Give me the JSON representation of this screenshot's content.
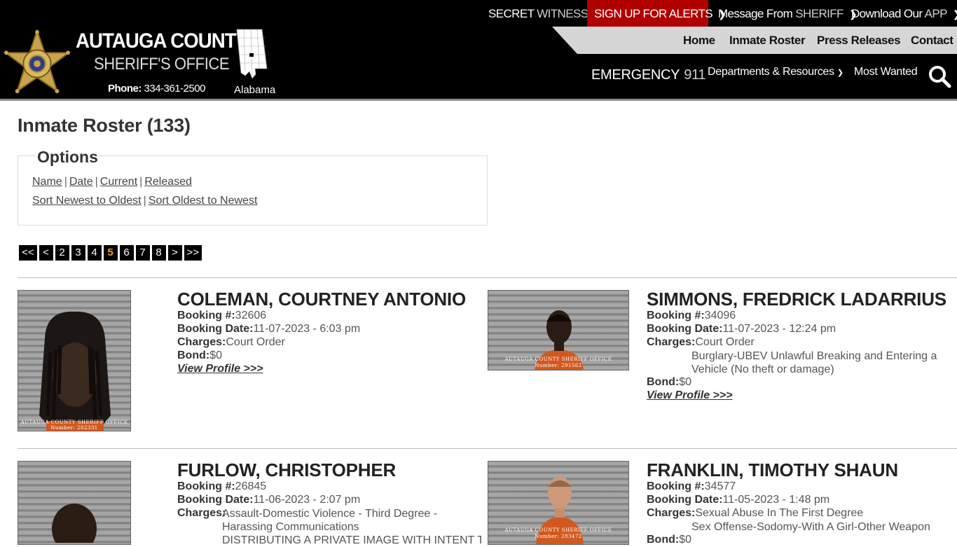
{
  "topbar": {
    "secret_witness_a": "SECRET",
    "secret_witness_b": "WITNESS",
    "alerts_a": "SIGN UP",
    "alerts_b": "FOR ALERTS",
    "message_a": "Message From",
    "message_b": "SHERIFF",
    "download_a": "Download Our",
    "download_b": "APP"
  },
  "header": {
    "brand_line1": "AUTAUGA COUNTY",
    "brand_line2": "SHERIFF'S OFFICE",
    "phone_label": "Phone:",
    "phone_number": "334-361-2500",
    "state": "Alabama"
  },
  "nav": {
    "home": "Home",
    "inmate_roster": "Inmate Roster",
    "press_releases": "Press Releases",
    "contact": "Contact",
    "emergency_label": "EMERGENCY",
    "emergency_number": "911",
    "departments": "Departments & Resources",
    "most_wanted": "Most Wanted"
  },
  "page": {
    "title": "Inmate Roster (133)",
    "options_legend": "Options",
    "filter_links": [
      "Name",
      "Date",
      "Current",
      "Released"
    ],
    "sort_links": [
      "Sort Newest to Oldest",
      "Sort Oldest to Newest"
    ],
    "pager": [
      "<<",
      "<",
      "2",
      "3",
      "4",
      "5",
      "6",
      "7",
      "8",
      ">",
      ">>"
    ],
    "pager_current": "5"
  },
  "inmates": [
    {
      "name": "COLEMAN, COURTNEY ANTONIO",
      "booking_no_label": "Booking #:",
      "booking_no": "32606",
      "booking_date_label": "Booking Date:",
      "booking_date": "11-07-2023 - 6:03 pm",
      "charges_label": "Charges:",
      "charges": [
        "Court Order"
      ],
      "bond_label": "Bond:",
      "bond": "$0",
      "view": "View Profile >>>",
      "photo_caption_a": "AUTAUGA COUNTY SHERIFF OFFICE",
      "photo_caption_b": "Number: 202331"
    },
    {
      "name": "SIMMONS, FREDRICK LADARRIUS",
      "booking_no_label": "Booking #:",
      "booking_no": "34096",
      "booking_date_label": "Booking Date:",
      "booking_date": "11-07-2023 - 12:24 pm",
      "charges_label": "Charges:",
      "charges": [
        "Court Order",
        "Burglary-UBEV Unlawful Breaking and Entering a Vehicle (No theft or damage)"
      ],
      "bond_label": "Bond:",
      "bond": "$0",
      "view": "View Profile >>>",
      "photo_caption_a": "AUTAUGA COUNTY SHERIFF OFFICE",
      "photo_caption_b": "Number: 291562"
    },
    {
      "name": "FURLOW, CHRISTOPHER",
      "booking_no_label": "Booking #:",
      "booking_no": "26845",
      "booking_date_label": "Booking Date:",
      "booking_date": "11-06-2023 - 2:07 pm",
      "charges_label": "Charges:",
      "charges": [
        "Assault-Domestic Violence - Third Degree - Harassing Communications",
        "DISTRIBUTING A PRIVATE IMAGE WITH INTENT TO"
      ]
    },
    {
      "name": "FRANKLIN, TIMOTHY SHAUN",
      "booking_no_label": "Booking #:",
      "booking_no": "34577",
      "booking_date_label": "Booking Date:",
      "booking_date": "11-05-2023 - 1:48 pm",
      "charges_label": "Charges:",
      "charges": [
        "Sexual Abuse In The First Degree",
        "Sex Offense-Sodomy-With A Girl-Other Weapon"
      ],
      "bond_label": "Bond:",
      "bond": "$0",
      "photo_caption_a": "AUTAUGA COUNTY SHERIFF OFFICE",
      "photo_caption_b": "Number: 283472"
    }
  ]
}
